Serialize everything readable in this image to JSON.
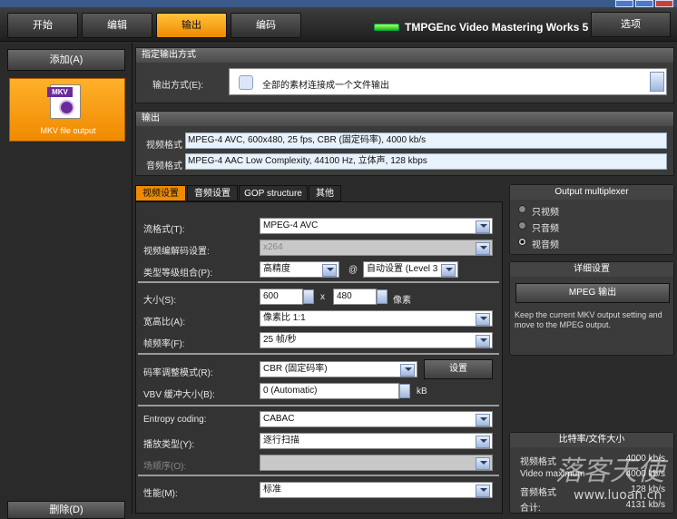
{
  "nav": {
    "tabs": [
      "开始",
      "编辑",
      "输出",
      "编码"
    ],
    "active_tab": "输出",
    "brand": "TMPGEnc Video Mastering Works 5",
    "options_label": "选项"
  },
  "left": {
    "add_label": "添加(A)",
    "output_item_label": "MKV file output",
    "output_icon_text": "MKV",
    "delete_label": "删除(D)"
  },
  "method": {
    "header": "指定输出方式",
    "label": "输出方式(E):",
    "value": "全部的素材连接成一个文件输出"
  },
  "output": {
    "header": "输出",
    "video_label": "视频格式",
    "video_value": "MPEG-4 AVC, 600x480, 25 fps, CBR (固定码率), 4000 kb/s",
    "audio_label": "音频格式",
    "audio_value": "MPEG-4 AAC Low Complexity, 44100 Hz, 立体声, 128 kbps"
  },
  "subtabs": [
    "视频设置",
    "音频设置",
    "GOP structure",
    "其他"
  ],
  "video": {
    "stream_label": "流格式(T):",
    "stream_value": "MPEG-4 AVC",
    "codec_label": "视频编解码设置:",
    "codec_value": "x264",
    "profile_label": "类型等级组合(P):",
    "profile_value": "高精度",
    "at_sign": "@",
    "level_value": "自动设置 (Level 3",
    "size_label": "大小(S):",
    "width_value": "600",
    "x_sign": "x",
    "height_value": "480",
    "px_unit": "像素",
    "aspect_label": "宽高比(A):",
    "aspect_value": "像素比 1:1",
    "fps_label": "帧频率(F):",
    "fps_value": "25 帧/秒",
    "rate_label": "码率调整模式(R):",
    "rate_value": "CBR (固定码率)",
    "rate_settings": "设置",
    "vbv_label": "VBV 缓冲大小(B):",
    "vbv_value": "0 (Automatic)",
    "vbv_unit": "kB",
    "entropy_label": "Entropy coding:",
    "entropy_value": "CABAC",
    "scan_label": "播放类型(Y):",
    "scan_value": "逐行扫描",
    "field_label": "场顺序(O):",
    "field_value": "",
    "perf_label": "性能(M):",
    "perf_value": "标准"
  },
  "mux": {
    "header": "Output multiplexer",
    "options": [
      "只视频",
      "只音频",
      "视音频"
    ],
    "selected": 2
  },
  "detail": {
    "header": "详细设置",
    "mpeg_button": "MPEG 输出",
    "note": "Keep the current MKV output setting and move to the MPEG output."
  },
  "bitrate": {
    "header": "比特率/文件大小",
    "rows": [
      {
        "label": "视频格式",
        "value": "4000 kb/s"
      },
      {
        "label": "Video maximum",
        "value": "4000 kb/s"
      },
      {
        "label": "音频格式",
        "value": "128 kb/s"
      },
      {
        "label": "合计:",
        "value": "4131 kb/s"
      }
    ]
  },
  "watermark": {
    "text": "落客天使",
    "url": "www.luoan.cn"
  }
}
